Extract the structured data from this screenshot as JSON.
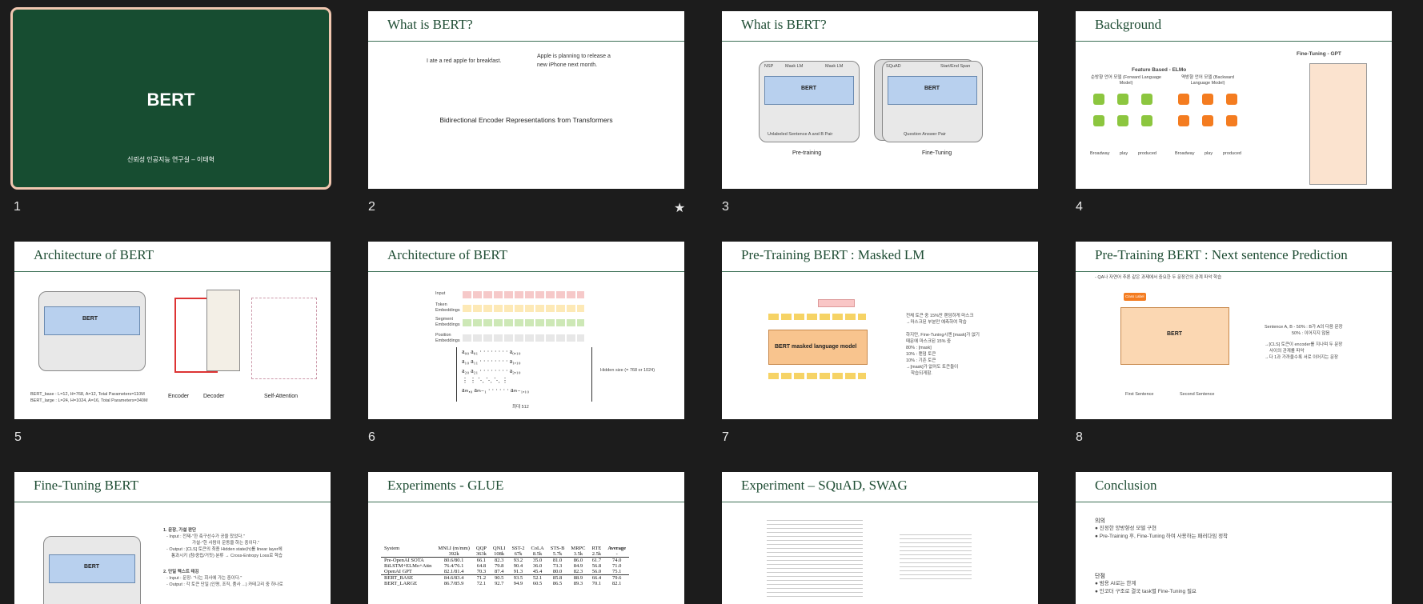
{
  "slides": [
    {
      "number": "1",
      "title": "BERT",
      "subtitle": "신뢰성 인공지능 연구실 – 이태혁"
    },
    {
      "number": "2",
      "title": "What is BERT?",
      "text_left": "I ate a red apple for breakfast.",
      "text_right_1": "Apple is planning to release a",
      "text_right_2": "new iPhone next month.",
      "caption": "Bidirectional Encoder Representations from Transformers",
      "star": "★"
    },
    {
      "number": "3",
      "title": "What is BERT?",
      "left_caption": "Pre-training",
      "right_caption": "Fine-Tuning",
      "left_bottom": "Unlabeled Sentence A and B Pair",
      "right_bottom": "Question Answer Pair",
      "model": "BERT",
      "task_left": "NSP",
      "task_mid": "Mask LM",
      "task_right": "Mask LM",
      "task_ft": "Start/End Span",
      "ft_label": "SQuAD"
    },
    {
      "number": "4",
      "title": "Background",
      "left_heading": "Feature Based - ELMo",
      "right_heading": "Fine-Tuning - GPT",
      "fwd": "순방향 언어 모델 (Forward Language Model)",
      "bwd": "역방향 언어 모델 (Backward Language Model)",
      "words": [
        "Broadway",
        "play",
        "produced"
      ]
    },
    {
      "number": "5",
      "title": "Architecture of BERT",
      "model": "BERT",
      "enc": "Encoder",
      "dec": "Decoder",
      "sa": "Self-Attention",
      "line1": "BERT_base : L=12, H=768, A=12, Total Parameters=110M",
      "line2": "BERT_large : L=24, H=1024, A=16, Total Parameters=340M"
    },
    {
      "number": "6",
      "title": "Architecture of BERT",
      "hidden": "Hidden size (= 768 or 1024)",
      "max": "최대 512",
      "rows": [
        "Input",
        "Token Embeddings",
        "Segment Embeddings",
        "Position Embeddings"
      ]
    },
    {
      "number": "7",
      "title": "Pre-Training BERT : Masked LM",
      "model": "BERT masked language model",
      "notes": [
        "전체 토큰 중 15%만 랜덤하게 마스크",
        "→마스크된 부분만 예측하여 학습",
        "하지만, Fine-Tuning시엔 [mask]가 없기",
        "때문에 마스크된 15% 중",
        "80% : [mask]",
        "10% : 랜덤 토큰",
        "10% : 기존 토큰",
        "→[mask]가 없어도 토큰들이",
        "학습되게함."
      ]
    },
    {
      "number": "8",
      "title": "Pre-Training BERT : Next sentence Prediction",
      "top_note": "- QA나 자연어 추론 같은 과제에서 중요한 두 문장간의 관계 파악 학습",
      "model": "BERT",
      "class_label": "Class Label",
      "first": "First Sentence",
      "second": "Second Sentence",
      "notes": [
        "Sentence A, B - 50% : B가 A의 다음 문장",
        "50% : 이어지지 않음",
        "→[CLS] 토큰이 encoder를 지나며 두 문장",
        "사이의 관계를 파악",
        "→다 1과 가까울수록 서로 이어지는 문장"
      ]
    },
    {
      "number": "9",
      "title": "Fine-Tuning  BERT",
      "notes": [
        "1. 문장, 가설 판단",
        "- Input : 전제-\"한 축구선수가 공을 찼었다.\"",
        "가설-\"한 사람이 운동을 하는 중이다.\"",
        "- Output : [CLS] 토큰의 최종 Hidden state(ℎ)를 linear layer에",
        "통과시키 (참/중립/거짓) 분류 → Cross-Entropy Loss로 학습",
        "2. 단일 텍스트 태깅",
        "- Input : 문장- \"나는 회사에 가는 중이다.\"",
        "- Output : 각 토큰 단일 (인명, 조직, 품사 ...) 카테고리 중 하나로"
      ]
    },
    {
      "number": "10",
      "title": "Experiments - GLUE",
      "headers": [
        "System",
        "MNLI (m/mm)",
        "QQP",
        "QNLI",
        "SST-2",
        "CoLA",
        "STS-B",
        "MRPC",
        "RTE",
        "Average"
      ],
      "sub": [
        "",
        "392k",
        "363k",
        "108k",
        "67k",
        "8.5k",
        "5.7k",
        "3.5k",
        "2.5k",
        "-"
      ],
      "rows": [
        [
          "Pre-OpenAI SOTA",
          "80.6/80.1",
          "66.1",
          "82.3",
          "93.2",
          "35.0",
          "81.0",
          "86.0",
          "61.7",
          "74.0"
        ],
        [
          "BiLSTM+ELMo+Attn",
          "76.4/76.1",
          "64.8",
          "79.8",
          "90.4",
          "36.0",
          "73.3",
          "84.9",
          "56.8",
          "71.0"
        ],
        [
          "OpenAI GPT",
          "82.1/81.4",
          "70.3",
          "87.4",
          "91.3",
          "45.4",
          "80.0",
          "82.3",
          "56.0",
          "75.1"
        ],
        [
          "BERT_BASE",
          "84.6/83.4",
          "71.2",
          "90.5",
          "93.5",
          "52.1",
          "85.8",
          "88.9",
          "66.4",
          "79.6"
        ],
        [
          "BERT_LARGE",
          "86.7/85.9",
          "72.1",
          "92.7",
          "94.9",
          "60.5",
          "86.5",
          "89.3",
          "70.1",
          "82.1"
        ]
      ]
    },
    {
      "number": "11",
      "title": "Experiment – SQuAD, SWAG"
    },
    {
      "number": "12",
      "title": "Conclusion",
      "h1": "의의",
      "b1": "진정한 양방향성 모델 구현",
      "b2": "Pre-Training 후, Fine-Tuning 하여 사용하는 패러다임 정착",
      "h2": "단점",
      "b3": "범용 AI로는 한계",
      "b4": "인코더 구조로 결국 task별 Fine-Tuning 필요"
    }
  ],
  "colors": {
    "background": "#1c1c1c",
    "title_green": "#174d31",
    "selection": "#f1c7b0"
  }
}
